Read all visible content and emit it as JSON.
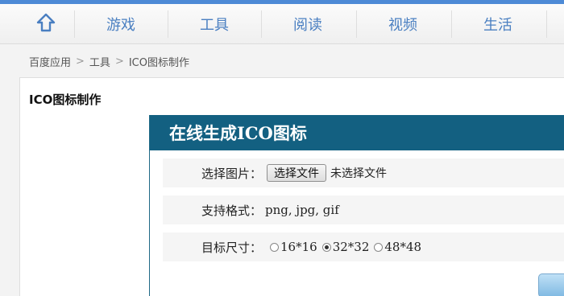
{
  "nav": {
    "home_icon": "home-icon",
    "items": [
      {
        "label": "游戏"
      },
      {
        "label": "工具"
      },
      {
        "label": "阅读"
      },
      {
        "label": "视频"
      },
      {
        "label": "生活"
      }
    ],
    "accent_color": "#4a7fc1"
  },
  "breadcrumb": {
    "items": [
      {
        "label": "百度应用"
      },
      {
        "label": "工具"
      },
      {
        "label": "ICO图标制作"
      }
    ],
    "separator": ">"
  },
  "panel": {
    "title": "ICO图标制作"
  },
  "converter": {
    "title": "在线生成ICO图标",
    "header_color": "#136081",
    "file_label": "选择图片：",
    "file_button": "选择文件",
    "file_status": "未选择文件",
    "format_label": "支持格式：",
    "formats": "png, jpg, gif",
    "size_label": "目标尺寸：",
    "sizes": [
      {
        "label": "16*16",
        "checked": false
      },
      {
        "label": "32*32",
        "checked": true
      },
      {
        "label": "48*48",
        "checked": false
      }
    ]
  }
}
